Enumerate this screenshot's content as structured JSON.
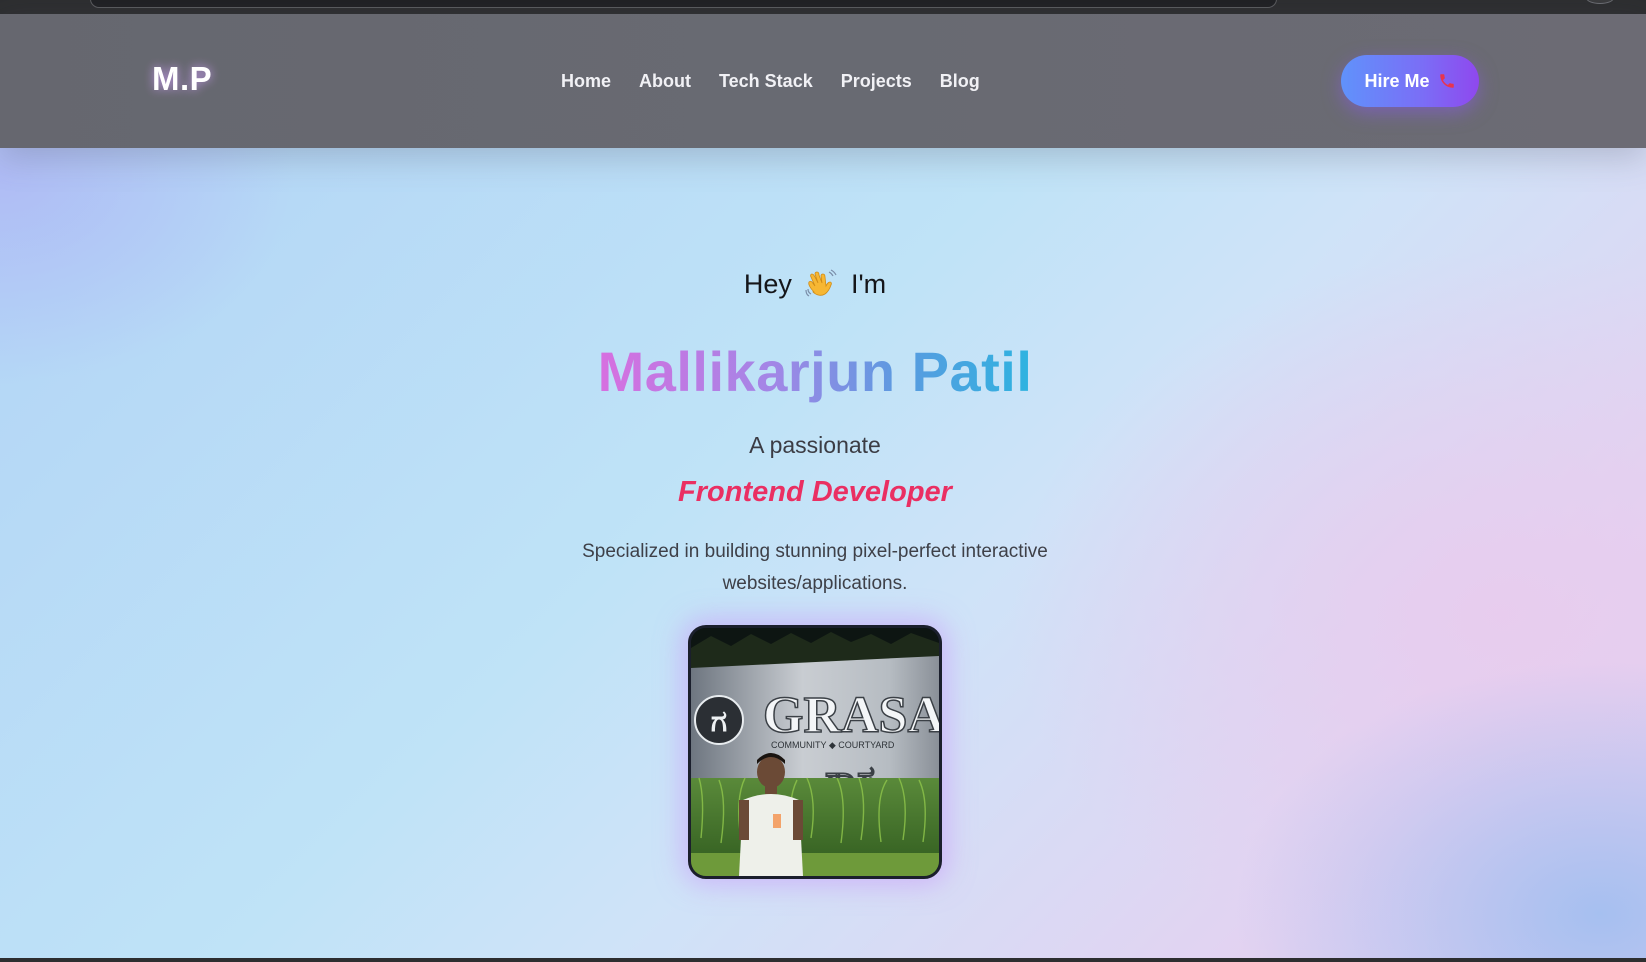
{
  "brand": {
    "logo_text": "M.P"
  },
  "nav": {
    "links": [
      {
        "label": "Home"
      },
      {
        "label": "About"
      },
      {
        "label": "Tech Stack"
      },
      {
        "label": "Projects"
      },
      {
        "label": "Blog"
      }
    ],
    "hire_button": {
      "label": "Hire Me",
      "icon": "phone-icon"
    }
  },
  "hero": {
    "greeting_before": "Hey",
    "greeting_icon": "waving-hand-icon",
    "greeting_after": "I'm",
    "name": "Mallikarjun Patil",
    "intro": "A passionate",
    "role": "Frontend Developer",
    "tagline": "Specialized in building stunning pixel-perfect interactive websites/applications.",
    "photo": {
      "sign_text": "GRASA",
      "sign_subtext": "COMMUNITY ◆ COURTYARD",
      "sign_kannada": "ಗ್ರಾಸ"
    }
  },
  "colors": {
    "role_accent": "#ea2f62",
    "name_gradient_start": "#d76fe0",
    "name_gradient_end": "#2eb3e0",
    "button_gradient_start": "#6092fb",
    "button_gradient_end": "#8f48ee",
    "navbar_bg": "#68696f"
  }
}
